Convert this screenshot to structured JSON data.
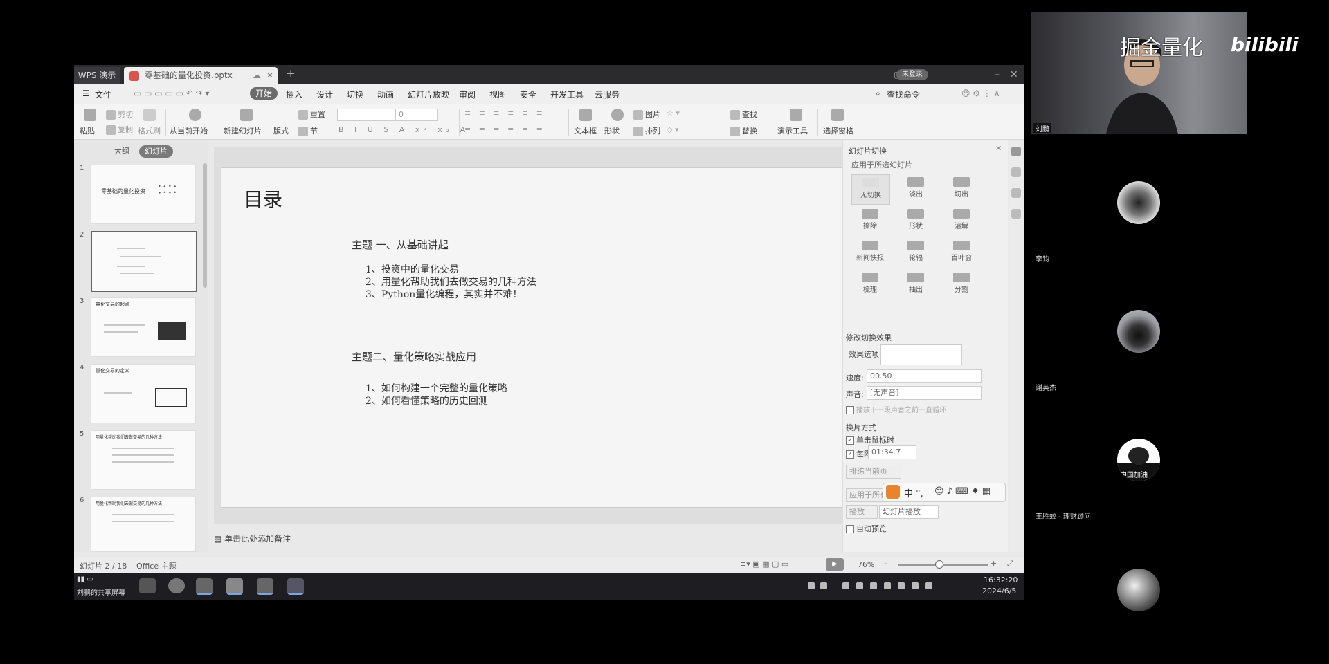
{
  "screen": {
    "titlebar": {
      "app_tab": "WPS 演示",
      "doc_tab": "零基础的量化投资.pptx",
      "login_label": "未登录"
    },
    "menubar": {
      "file": "文件",
      "items": [
        "开始",
        "插入",
        "设计",
        "切换",
        "动画",
        "幻灯片放映",
        "审阅",
        "视图",
        "安全",
        "开发工具",
        "云服务"
      ],
      "search_label": "查找命令"
    },
    "ribbon": {
      "paste": "粘贴",
      "cut": "剪切",
      "copy": "复制",
      "format_painter": "格式刷",
      "from_current": "从当前开始",
      "new_slide": "新建幻灯片",
      "layout": "版式",
      "section": "节",
      "reset": "重置",
      "font_size": "0",
      "textbox": "文本框",
      "shape": "形状",
      "arrange": "排列",
      "picture": "图片",
      "find": "查找",
      "replace": "替换",
      "present_tools": "演示工具",
      "select_pane": "选择窗格"
    },
    "left_panel": {
      "tabs": [
        "大纲",
        "幻灯片"
      ],
      "thumbs": [
        {
          "num": "1",
          "text": "零基础的量化投资"
        },
        {
          "num": "2",
          "text": ""
        },
        {
          "num": "3",
          "text": "量化交易的起点"
        },
        {
          "num": "4",
          "text": "量化交易的定义"
        },
        {
          "num": "5",
          "text": "用量化帮助我们去做交易的几种方法"
        },
        {
          "num": "6",
          "text": "用量化帮助我们去做交易的几种方法"
        }
      ]
    },
    "slide": {
      "title": "目录",
      "topic1": "主题 一、从基础讲起",
      "topic1_items": [
        "1、投资中的量化交易",
        "2、用量化帮助我们去做交易的几种方法",
        "3、Python量化编程，其实并不难！"
      ],
      "topic2": "主题二、量化策略实战应用",
      "topic2_items": [
        "1、如何构建一个完整的量化策略",
        "2、如何看懂策略的历史回测"
      ]
    },
    "notes_placeholder": "单击此处添加备注",
    "right_pane": {
      "header": "幻灯片切换",
      "apply_selected": "应用于所选幻灯片",
      "transitions": [
        "无切换",
        "淡出",
        "切出",
        "擦除",
        "形状",
        "溶解",
        "新闻快报",
        "轮辐",
        "百叶窗",
        "梳理",
        "抽出",
        "分割"
      ],
      "modify_effect": "修改切换效果",
      "effect_options": "效果选项:",
      "speed_label": "速度:",
      "speed_value": "00.50",
      "sound_label": "声音:",
      "sound_value": "[无声音]",
      "loop_label": "播放下一段声音之前一直循环",
      "advance_header": "换片方式",
      "on_click": "单击鼠标时",
      "every": "每隔",
      "every_value": "01:34.7",
      "exclude": "排练当前页",
      "apply_all": "应用于所有",
      "play": "播放",
      "slideshow": "幻灯片播放",
      "autopreview": "自动预览"
    },
    "ime": {
      "chars": "中 °,"
    },
    "statusbar": {
      "slide_info": "幻灯片 2 / 18",
      "theme": "Office 主题",
      "zoom": "76%",
      "zoom_level_pct": 45
    },
    "taskbar": {
      "share_label": "刘鹏的共享屏幕",
      "time": "16:32:20",
      "date": "2024/6/5"
    }
  },
  "webcam": {
    "overlay_text": "掘金量化",
    "logo_text": "bilibili",
    "name": "刘鹏"
  },
  "participants": [
    {
      "name": "李钧"
    },
    {
      "name": "谢英杰"
    },
    {
      "name": "王胜蛟 - 理财顾问"
    },
    {
      "name": ""
    }
  ],
  "avatar3_text": "中国加油",
  "colors": {
    "background": "#000000",
    "accent_tab": "#6b6b6b",
    "ppt_icon": "#d9534f"
  }
}
